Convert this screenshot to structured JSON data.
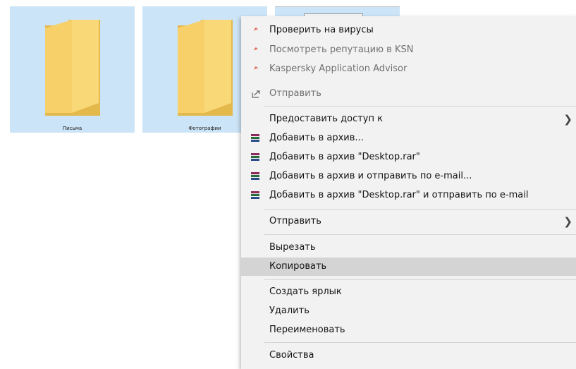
{
  "desktop": {
    "folders": [
      {
        "name": "Письма"
      },
      {
        "name": "Фотографии"
      }
    ]
  },
  "context_menu": {
    "kaspersky_scan": "Проверить на вирусы",
    "kaspersky_reputation": "Посмотреть репутацию в KSN",
    "kaspersky_advisor": "Kaspersky Application Advisor",
    "share_send": "Отправить",
    "give_access": "Предоставить доступ к",
    "add_archive": "Добавить в архив...",
    "add_desktop_rar": "Добавить в архив \"Desktop.rar\"",
    "add_archive_email": "Добавить в архив и отправить по e-mail...",
    "add_desktop_rar_email": "Добавить в архив \"Desktop.rar\" и отправить по e-mail",
    "send_to": "Отправить",
    "cut": "Вырезать",
    "copy": "Копировать",
    "create_shortcut": "Создать ярлык",
    "delete": "Удалить",
    "rename": "Переименовать",
    "properties": "Свойства"
  }
}
